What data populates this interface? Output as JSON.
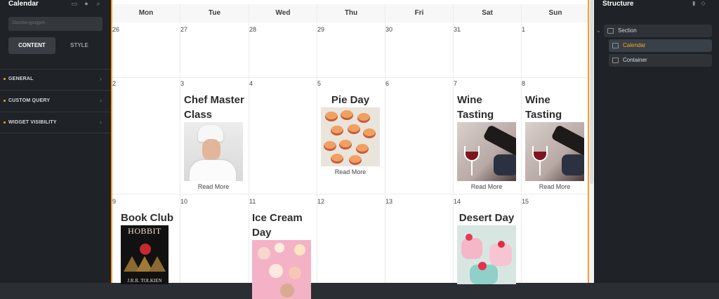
{
  "left_panel": {
    "title": "Calendar",
    "search_placeholder": "Gbsnbw-gpuggvh",
    "tabs": [
      {
        "label": "CONTENT"
      },
      {
        "label": "STYLE"
      }
    ],
    "sections": [
      {
        "label": "GENERAL"
      },
      {
        "label": "CUSTOM QUERY"
      },
      {
        "label": "WIDGET VISIBILITY"
      }
    ]
  },
  "calendar": {
    "weekdays": [
      "Mon",
      "Tue",
      "Wed",
      "Thu",
      "Fri",
      "Sat",
      "Sun"
    ],
    "week1": [
      "26",
      "27",
      "28",
      "29",
      "30",
      "31",
      "1"
    ],
    "week2": [
      "2",
      "3",
      "4",
      "5",
      "6",
      "7",
      "8"
    ],
    "week3": [
      "9",
      "10",
      "11",
      "12",
      "13",
      "14",
      "15"
    ],
    "events": [
      {
        "title": "Chef Master Class",
        "link": "Read More"
      },
      {
        "title": "Pie Day",
        "link": "Read More"
      },
      {
        "title": "Wine Tasting",
        "link": "Read More"
      },
      {
        "title": "Wine Tasting",
        "link": "Read More"
      },
      {
        "title": "Book Club",
        "cover_title": "HOBBIT",
        "cover_author": "J.R.R. TOLKIEN"
      },
      {
        "title": "Ice Cream Day"
      },
      {
        "title": "Desert Day"
      }
    ]
  },
  "right_panel": {
    "title": "Structure",
    "tree": [
      {
        "label": "Section"
      },
      {
        "label": "Calendar"
      },
      {
        "label": "Container"
      }
    ]
  },
  "colors": {
    "accent": "#f5a623",
    "panel_bg": "#1f2226",
    "canvas_border": "#f0a030"
  }
}
